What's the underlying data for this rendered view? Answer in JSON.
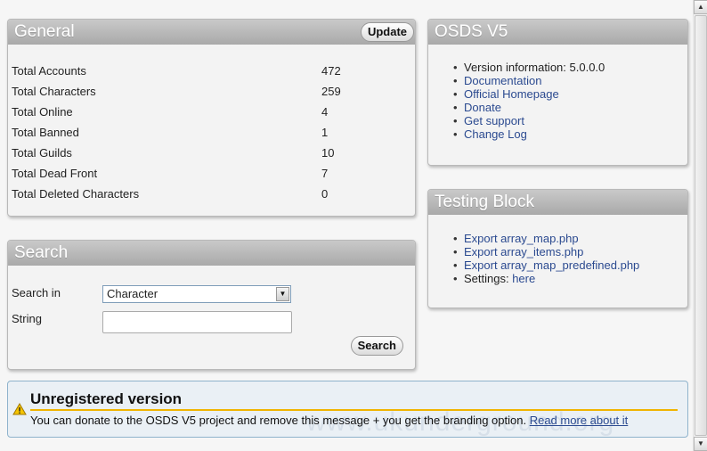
{
  "general": {
    "title": "General",
    "update_label": "Update",
    "stats": [
      {
        "label": "Total Accounts",
        "value": "472"
      },
      {
        "label": "Total Characters",
        "value": "259"
      },
      {
        "label": "Total Online",
        "value": "4"
      },
      {
        "label": "Total Banned",
        "value": "1"
      },
      {
        "label": "Total Guilds",
        "value": "10"
      },
      {
        "label": "Total Dead Front",
        "value": "7"
      },
      {
        "label": "Total Deleted Characters",
        "value": "0"
      }
    ]
  },
  "search": {
    "title": "Search",
    "search_in_label": "Search in",
    "search_in_value": "Character",
    "string_label": "String",
    "string_value": "",
    "button_label": "Search"
  },
  "osds": {
    "title": "OSDS V5",
    "version_text": "Version information: 5.0.0.0",
    "links": [
      "Documentation",
      "Official Homepage",
      "Donate",
      "Get support",
      "Change Log"
    ]
  },
  "testing": {
    "title": "Testing Block",
    "links": [
      "Export array_map.php",
      "Export array_items.php",
      "Export array_map_predefined.php"
    ],
    "settings_text": "Settings: ",
    "settings_link": "here"
  },
  "notice": {
    "title": "Unregistered version",
    "text": "You can donate to the OSDS V5 project and remove this message + you get the branding option.",
    "link": "Read more about it",
    "watermark": "www.ukunderground.org"
  },
  "colors": {
    "header_gradient_top": "#c9c9c9",
    "header_gradient_bottom": "#a9a9a9",
    "link": "#2b4a90",
    "notice_bg": "#eaf0f5",
    "notice_accent": "#f0b400"
  },
  "icons": {
    "warning": "warning-icon",
    "dropdown": "chevron-down-icon",
    "scroll_up": "arrow-up-icon",
    "scroll_down": "arrow-down-icon"
  }
}
